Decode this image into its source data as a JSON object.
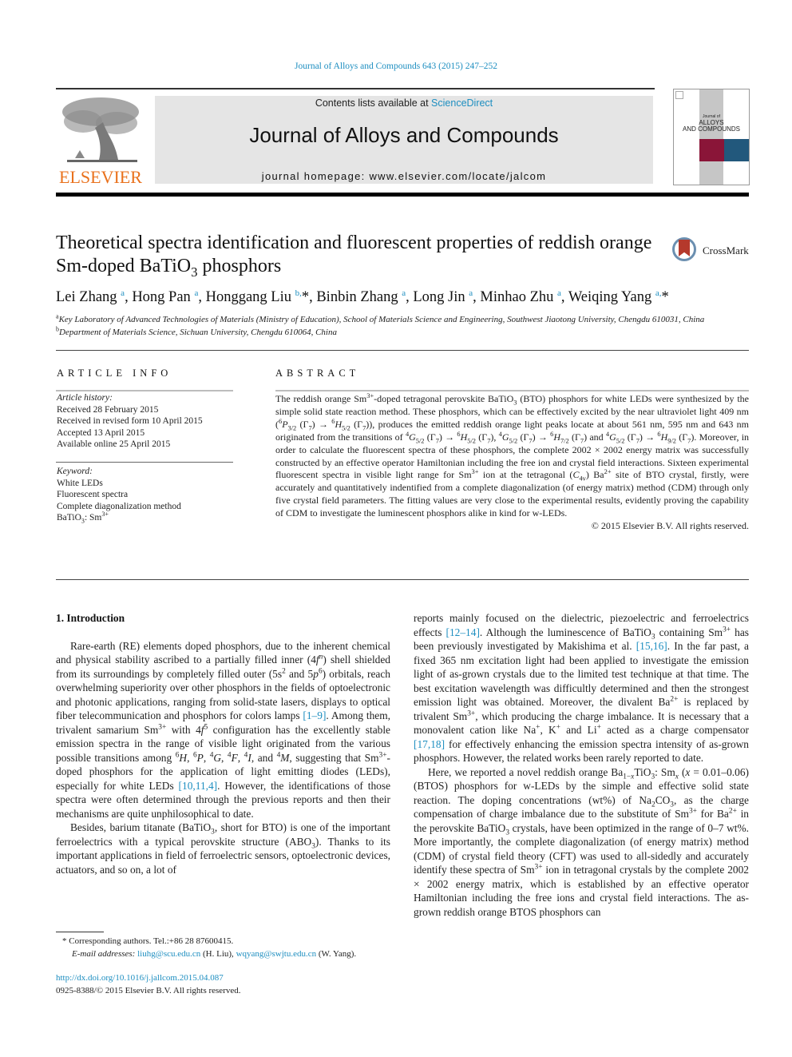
{
  "header": {
    "journal_ref": "Journal of Alloys and Compounds 643 (2015) 247–252",
    "contents_prefix": "Contents lists available at ",
    "contents_link": "ScienceDirect",
    "journal_title": "Journal of Alloys and Compounds",
    "homepage": "journal homepage: www.elsevier.com/locate/jalcom",
    "publisher_logo": "ELSEVIER",
    "cover": {
      "line1": "Journal of",
      "line2": "ALLOYS",
      "line3": "AND COMPOUNDS",
      "accent_red": "#8a1538",
      "accent_blue": "#22587c"
    },
    "crossmark_label": "CrossMark"
  },
  "article": {
    "title_html": "Theoretical spectra identification and fluorescent properties of reddish orange Sm-doped BaTiO<sub>3</sub> phosphors",
    "authors_html": "Lei Zhang <sup>a</sup>, Hong Pan <sup>a</sup>, Honggang Liu <sup>b,</sup>*, Binbin Zhang <sup>a</sup>, Long Jin <sup>a</sup>, Minhao Zhu <sup>a</sup>, Weiqing Yang <sup>a,</sup>*",
    "affiliations": [
      {
        "mark": "a",
        "text": "Key Laboratory of Advanced Technologies of Materials (Ministry of Education), School of Materials Science and Engineering, Southwest Jiaotong University, Chengdu 610031, China"
      },
      {
        "mark": "b",
        "text": "Department of Materials Science, Sichuan University, Chengdu 610064, China"
      }
    ]
  },
  "article_info": {
    "heading": "ARTICLE INFO",
    "history_label": "Article history:",
    "history": [
      "Received 28 February 2015",
      "Received in revised form 10 April 2015",
      "Accepted 13 April 2015",
      "Available online 25 April 2015"
    ],
    "keywords_label": "Keyword:",
    "keywords_html": [
      "White LEDs",
      "Fluorescent spectra",
      "Complete diagonalization method",
      "BaTiO<sub>3</sub>: Sm<sup>3+</sup>"
    ]
  },
  "abstract": {
    "heading": "ABSTRACT",
    "body_html": "The reddish orange Sm<sup>3+</sup>-doped tetragonal perovskite BaTiO<sub>3</sub> (BTO) phosphors for white LEDs were synthesized by the simple solid state reaction method. These phosphors, which can be effectively excited by the near ultraviolet light 409&nbsp;nm (<sup>6</sup><i>P</i><sub>3/2</sub> (Γ<sub>7</sub>) → <sup>6</sup><i>H</i><sub>5/2</sub> (Γ<sub>7</sub>)), produces the emitted reddish orange light peaks locate at about 561 nm, 595 nm and 643 nm originated from the transitions of <sup>4</sup><i>G</i><sub>5/2</sub> (Γ<sub>7</sub>) → <sup>6</sup><i>H</i><sub>5/2</sub> (Γ<sub>7</sub>), <sup>4</sup><i>G</i><sub>5/2</sub> (Γ<sub>7</sub>) → <sup>6</sup><i>H</i><sub>7/2</sub> (Γ<sub>7</sub>) and <sup>4</sup><i>G</i><sub>5/2</sub> (Γ<sub>7</sub>) → <sup>6</sup><i>H</i><sub>9/2</sub> (Γ<sub>7</sub>). Moreover, in order to calculate the fluorescent spectra of these phosphors, the complete 2002 × 2002 energy matrix was successfully constructed by an effective operator Hamiltonian including the free ion and crystal field interactions. Sixteen experimental fluorescent spectra in visible light range for Sm<sup>3+</sup> ion at the tetragonal (<i>C</i><sub>4v</sub>) Ba<sup>2+</sup> site of BTO crystal, firstly, were accurately and quantitatively indentified from a complete diagonalization (of energy matrix) method (CDM) through only five crystal field parameters. The fitting values are very close to the experimental results, evidently proving the capability of CDM to investigate the luminescent phosphors alike in kind for w-LEDs.",
    "copyright": "© 2015 Elsevier B.V. All rights reserved."
  },
  "body": {
    "section_heading": "1. Introduction",
    "left_paragraphs_html": [
      "Rare-earth (RE) elements doped phosphors, due to the inherent chemical and physical stability ascribed to a partially filled inner (4<i>f</i><sup><i>n</i></sup>) shell shielded from its surroundings by completely filled outer (5s<sup>2</sup> and 5<i>p</i><sup>6</sup>) orbitals, reach overwhelming superiority over other phosphors in the fields of optoelectronic and photonic applications, ranging from solid-state lasers, displays to optical fiber telecommunication and phosphors for colors lamps <span class=\"link\">[1–9]</span>. Among them, trivalent samarium Sm<sup>3+</sup> with 4<i>f</i><sup>5</sup> configuration has the excellently stable emission spectra in the range of visible light originated from the various possible transitions among <sup>6</sup><i>H</i>, <sup>6</sup><i>P</i>, <sup>4</sup><i>G</i>, <sup>4</sup><i>F</i>, <sup>4</sup><i>I</i>, and <sup>4</sup><i>M</i>, suggesting that Sm<sup>3+</sup>-doped phosphors for the application of light emitting diodes (LEDs), especially for white LEDs <span class=\"link\">[10,11,4]</span>. However, the identifications of those spectra were often determined through the previous reports and then their mechanisms are quite unphilosophical to date.",
      "Besides, barium titanate (BaTiO<sub>3</sub>, short for BTO) is one of the important ferroelectrics with a typical perovskite structure (ABO<sub>3</sub>). Thanks to its important applications in field of ferroelectric sensors, optoelectronic devices, actuators, and so on, a lot of"
    ],
    "right_paragraphs_html": [
      "reports mainly focused on the dielectric, piezoelectric and ferroelectrics effects <span class=\"link\">[12–14]</span>. Although the luminescence of BaTiO<sub>3</sub> containing Sm<sup>3+</sup> has been previously investigated by Makishima et al. <span class=\"link\">[15,16]</span>. In the far past, a fixed 365&nbsp;nm excitation light had been applied to investigate the emission light of as-grown crystals due to the limited test technique at that time. The best excitation wavelength was difficultly determined and then the strongest emission light was obtained. Moreover, the divalent Ba<sup>2+</sup> is replaced by trivalent Sm<sup>3+</sup>, which producing the charge imbalance. It is necessary that a monovalent cation like Na<sup>+</sup>, K<sup>+</sup> and Li<sup>+</sup> acted as a charge compensator <span class=\"link\">[17,18]</span> for effectively enhancing the emission spectra intensity of as-grown phosphors. However, the related works been rarely reported to date.",
      "Here, we reported a novel reddish orange Ba<sub>1−<i>x</i></sub>TiO<sub>3</sub>: Sm<sub><i>x</i></sub> (<i>x</i> = 0.01–0.06) (BTOS) phosphors for w-LEDs by the simple and effective solid state reaction. The doping concentrations (wt%) of Na<sub>2</sub>CO<sub>3</sub>, as the charge compensation of charge imbalance due to the substitute of Sm<sup>3+</sup> for Ba<sup>2+</sup> in the perovskite BaTiO<sub>3</sub> crystals, have been optimized in the range of 0–7 wt%. More importantly, the complete diagonalization (of energy matrix) method (CDM) of crystal field theory (CFT) was used to all-sidedly and accurately identify these spectra of Sm<sup>3+</sup> ion in tetragonal crystals by the complete 2002 × 2002 energy matrix, which is established by an effective operator Hamiltonian including the free ions and crystal field interactions. The as-grown reddish orange BTOS phosphors can"
    ]
  },
  "footnote": {
    "corresponding": "* Corresponding authors. Tel.:+86 28 87600415.",
    "email_label": "E-mail addresses: ",
    "emails": [
      {
        "address": "liuhg@scu.edu.cn",
        "name": " (H. Liu), "
      },
      {
        "address": "wqyang@swjtu.edu.cn",
        "name": " (W. Yang)."
      }
    ],
    "doi": "http://dx.doi.org/10.1016/j.jallcom.2015.04.087",
    "issn": "0925-8388/© 2015 Elsevier B.V. All rights reserved."
  }
}
